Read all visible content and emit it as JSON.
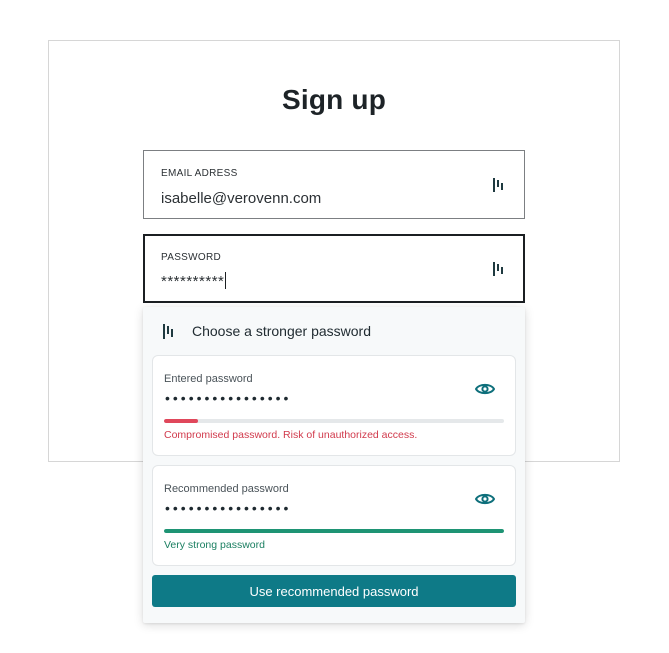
{
  "page": {
    "title": "Sign up"
  },
  "email": {
    "label": "EMAIL ADRESS",
    "value": "isabelle@verovenn.com"
  },
  "password": {
    "label": "PASSWORD",
    "value": "**********"
  },
  "icons": {
    "field_manager": "password-manager-icon",
    "reveal": "eye-icon"
  },
  "suggestion": {
    "title": "Choose a stronger password",
    "entered": {
      "label": "Entered password",
      "masked": "••••••••••••••••",
      "strength": 0.1,
      "status": "Compromised password. Risk of unauthorized access."
    },
    "recommended": {
      "label": "Recommended password",
      "masked": "••••••••••••••••",
      "strength": 1.0,
      "status": "Very strong password"
    },
    "button_label": "Use recommended password"
  },
  "colors": {
    "accent": "#0e7a87",
    "weak": "#e0475b",
    "strong": "#1e9474"
  }
}
